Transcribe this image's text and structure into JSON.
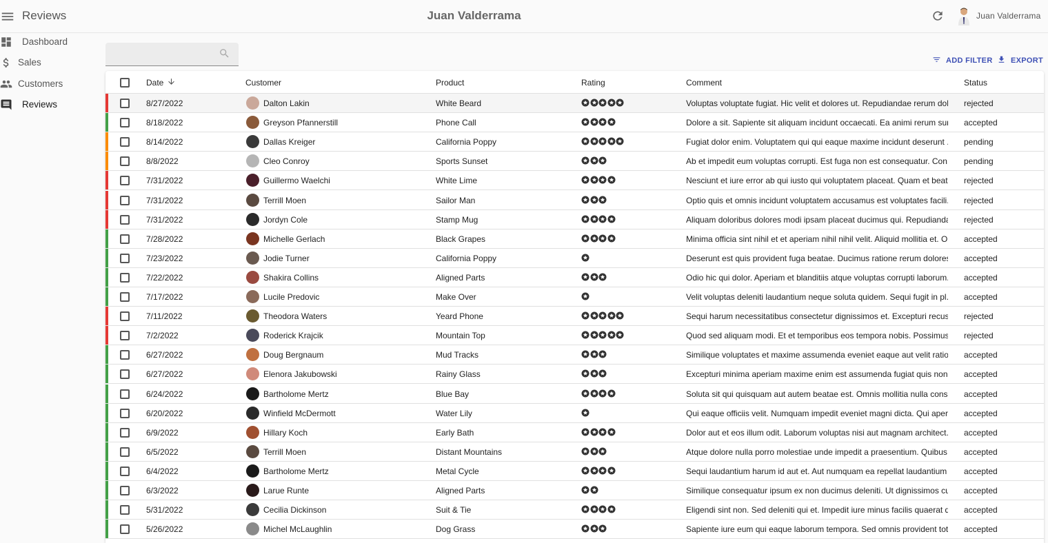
{
  "app": {
    "title": "Reviews",
    "center_title": "Juan Valderrama",
    "user_name": "Juan Valderrama"
  },
  "sidebar": {
    "items": [
      {
        "label": "Dashboard",
        "icon": "dashboard-icon"
      },
      {
        "label": "Sales",
        "icon": "dollar-icon"
      },
      {
        "label": "Customers",
        "icon": "people-icon"
      },
      {
        "label": "Reviews",
        "icon": "comment-icon",
        "active": true
      }
    ]
  },
  "search": {
    "placeholder": "",
    "value": ""
  },
  "toolbar": {
    "add_filter_label": "ADD FILTER",
    "export_label": "EXPORT"
  },
  "colors": {
    "accent": "#3f51b5",
    "rejected": "#e53935",
    "accepted": "#43a047",
    "pending": "#fb8c00"
  },
  "table": {
    "headers": {
      "date": "Date",
      "customer": "Customer",
      "product": "Product",
      "rating": "Rating",
      "comment": "Comment",
      "status": "Status"
    },
    "rows": [
      {
        "date": "8/27/2022",
        "customer": "Dalton Lakin",
        "product": "White Beard",
        "rating": 5,
        "comment": "Voluptas voluptate fugiat. Hic velit et dolores ut. Repudiandae rerum dol...",
        "status": "rejected",
        "avatar": "#caa89a"
      },
      {
        "date": "8/18/2022",
        "customer": "Greyson Pfannerstill",
        "product": "Phone Call",
        "rating": 4,
        "comment": "Dolore a sit. Sapiente sit aliquam incidunt occaecati. Ea animi rerum sun...",
        "status": "accepted",
        "avatar": "#8a5a3a"
      },
      {
        "date": "8/14/2022",
        "customer": "Dallas Kreiger",
        "product": "California Poppy",
        "rating": 5,
        "comment": "Fugiat dolor enim. Voluptatem qui qui eaque maxime incidunt deserunt ...",
        "status": "pending",
        "avatar": "#3a3a3a"
      },
      {
        "date": "8/8/2022",
        "customer": "Cleo Conroy",
        "product": "Sports Sunset",
        "rating": 3,
        "comment": "Ab et impedit eum voluptas corrupti. Est fuga non est consequatur. Con...",
        "status": "pending",
        "avatar": "#b5b5b5"
      },
      {
        "date": "7/31/2022",
        "customer": "Guillermo Waelchi",
        "product": "White Lime",
        "rating": 4,
        "comment": "Nesciunt et iure error ab qui iusto qui voluptatem placeat. Quam et beat...",
        "status": "rejected",
        "avatar": "#4a1f2a"
      },
      {
        "date": "7/31/2022",
        "customer": "Terrill Moen",
        "product": "Sailor Man",
        "rating": 3,
        "comment": "Optio quis et omnis incidunt voluptatem accusamus est voluptates facili...",
        "status": "rejected",
        "avatar": "#5a4a40"
      },
      {
        "date": "7/31/2022",
        "customer": "Jordyn Cole",
        "product": "Stamp Mug",
        "rating": 4,
        "comment": "Aliquam doloribus dolores modi ipsam placeat ducimus qui. Repudianda...",
        "status": "rejected",
        "avatar": "#2a2a2a"
      },
      {
        "date": "7/28/2022",
        "customer": "Michelle Gerlach",
        "product": "Black Grapes",
        "rating": 4,
        "comment": "Minima officia sint nihil et et aperiam nihil nihil velit. Aliquid mollitia et. O...",
        "status": "accepted",
        "avatar": "#7a3520"
      },
      {
        "date": "7/23/2022",
        "customer": "Jodie Turner",
        "product": "California Poppy",
        "rating": 1,
        "comment": "Deserunt est quis provident fuga beatae. Ducimus ratione rerum dolores...",
        "status": "accepted",
        "avatar": "#6a5a50"
      },
      {
        "date": "7/22/2022",
        "customer": "Shakira Collins",
        "product": "Aligned Parts",
        "rating": 3,
        "comment": "Odio hic qui dolor. Aperiam et blanditiis atque voluptas corrupti laborum...",
        "status": "accepted",
        "avatar": "#9a4a40"
      },
      {
        "date": "7/17/2022",
        "customer": "Lucile Predovic",
        "product": "Make Over",
        "rating": 1,
        "comment": "Velit voluptas deleniti laudantium neque soluta quidem. Sequi fugit in pl...",
        "status": "accepted",
        "avatar": "#8a6a5a"
      },
      {
        "date": "7/11/2022",
        "customer": "Theodora Waters",
        "product": "Yeard Phone",
        "rating": 5,
        "comment": "Sequi harum necessitatibus consectetur dignissimos et. Excepturi recus...",
        "status": "rejected",
        "avatar": "#6a5a30"
      },
      {
        "date": "7/2/2022",
        "customer": "Roderick Krajcik",
        "product": "Mountain Top",
        "rating": 5,
        "comment": "Quod sed aliquam modi. Et et temporibus eos tempora nobis. Possimus ...",
        "status": "rejected",
        "avatar": "#4a4a5a"
      },
      {
        "date": "6/27/2022",
        "customer": "Doug Bergnaum",
        "product": "Mud Tracks",
        "rating": 3,
        "comment": "Similique voluptates et maxime assumenda eveniet eaque aut velit ratio...",
        "status": "accepted",
        "avatar": "#c07040"
      },
      {
        "date": "6/27/2022",
        "customer": "Elenora Jakubowski",
        "product": "Rainy Glass",
        "rating": 3,
        "comment": "Excepturi minima aperiam maxime enim est assumenda fugiat quis non....",
        "status": "accepted",
        "avatar": "#d08a7a"
      },
      {
        "date": "6/24/2022",
        "customer": "Bartholome Mertz",
        "product": "Blue Bay",
        "rating": 4,
        "comment": "Soluta sit qui quisquam aut autem beatae est. Omnis mollitia nulla cons...",
        "status": "accepted",
        "avatar": "#1a1a1a"
      },
      {
        "date": "6/20/2022",
        "customer": "Winfield McDermott",
        "product": "Water Lily",
        "rating": 1,
        "comment": "Qui eaque officiis velit. Numquam impedit eveniet magni dicta. Qui aperi...",
        "status": "accepted",
        "avatar": "#2a2a2a"
      },
      {
        "date": "6/9/2022",
        "customer": "Hillary Koch",
        "product": "Early Bath",
        "rating": 4,
        "comment": "Dolor aut et eos illum odit. Laborum voluptas nisi aut magnam architect...",
        "status": "accepted",
        "avatar": "#a05030"
      },
      {
        "date": "6/5/2022",
        "customer": "Terrill Moen",
        "product": "Distant Mountains",
        "rating": 3,
        "comment": "Atque dolore nulla porro molestiae unde impedit a praesentium. Quibus...",
        "status": "accepted",
        "avatar": "#5a4a40"
      },
      {
        "date": "6/4/2022",
        "customer": "Bartholome Mertz",
        "product": "Metal Cycle",
        "rating": 4,
        "comment": "Sequi laudantium harum id aut et. Aut numquam ea repellat laudantium ...",
        "status": "accepted",
        "avatar": "#1a1a1a"
      },
      {
        "date": "6/3/2022",
        "customer": "Larue Runte",
        "product": "Aligned Parts",
        "rating": 2,
        "comment": "Similique consequatur ipsum ex non ducimus deleniti. Ut dignissimos cul...",
        "status": "accepted",
        "avatar": "#2a1a1a"
      },
      {
        "date": "5/31/2022",
        "customer": "Cecilia Dickinson",
        "product": "Suit & Tie",
        "rating": 4,
        "comment": "Eligendi sint non. Sed deleniti qui et. Impedit iure minus facilis quaerat q...",
        "status": "accepted",
        "avatar": "#3a3a3a"
      },
      {
        "date": "5/26/2022",
        "customer": "Michel McLaughlin",
        "product": "Dog Grass",
        "rating": 3,
        "comment": "Sapiente iure eum qui eaque laborum tempora. Sed omnis provident tot...",
        "status": "accepted",
        "avatar": "#8a8a8a"
      }
    ]
  }
}
